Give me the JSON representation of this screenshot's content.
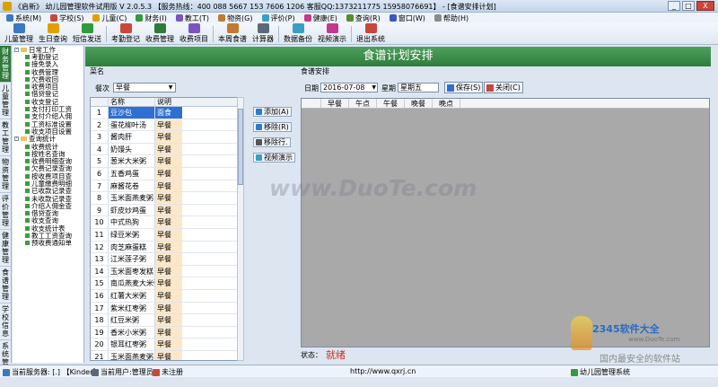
{
  "window": {
    "title": "《启新》 幼儿园管理软件试用版 V 2.0.5.3 【服务热线：400 088 5667  153 7606 1206  客服QQ:1373211775  15958076691】 - [食谱安排计划]",
    "controls": [
      "_",
      "□",
      "X"
    ]
  },
  "menu": [
    {
      "label": "系统(M)",
      "color": "#3a78c2"
    },
    {
      "label": "学校(S)",
      "color": "#c9463d"
    },
    {
      "label": "儿童(C)",
      "color": "#e0a000"
    },
    {
      "label": "财务(I)",
      "color": "#2f9a3f"
    },
    {
      "label": "教工(T)",
      "color": "#7a55c2"
    },
    {
      "label": "物资(G)",
      "color": "#c27a2f"
    },
    {
      "label": "评价(P)",
      "color": "#3a9ec2"
    },
    {
      "label": "健康(E)",
      "color": "#c23a8a"
    },
    {
      "label": "查询(R)",
      "color": "#5a8a2f"
    },
    {
      "label": "窗口(W)",
      "color": "#3a58c2"
    },
    {
      "label": "帮助(H)",
      "color": "#8a8a8a"
    }
  ],
  "toolbar": [
    {
      "label": "儿童管理",
      "color": "#3a78c2"
    },
    {
      "label": "生日查询",
      "color": "#e0a000"
    },
    {
      "label": "短信发送",
      "color": "#2f9a3f"
    },
    {
      "label": "考勤登记",
      "color": "#c9463d"
    },
    {
      "label": "收费管理",
      "color": "#2f7a3a"
    },
    {
      "label": "收费项目",
      "color": "#7a55c2"
    },
    {
      "label": "本周食谱",
      "color": "#c27a2f"
    },
    {
      "label": "计算器",
      "color": "#5a6a7a"
    },
    {
      "label": "数据备份",
      "color": "#3a9ec2"
    },
    {
      "label": "视频演示",
      "color": "#c23a8a"
    },
    {
      "label": "退出系统",
      "color": "#c9463d"
    }
  ],
  "sidetabs": [
    "财务管理",
    "儿童管理",
    "教工管理",
    "物资管理",
    "评价管理",
    "健康管理",
    "食谱管理",
    "学校信息",
    "系统管理"
  ],
  "tree": {
    "groups": [
      {
        "label": "日常工作",
        "items": [
          "考勤登记",
          "接免录入",
          "收费管理",
          "欠费收回",
          "收费项目",
          "借贷登记",
          "收支登记",
          "支付打印工资",
          "支付介绍人佣",
          "工资标准设置",
          "收支项目设置"
        ]
      },
      {
        "label": "查询统计",
        "items": [
          "收费统计",
          "按姓名查询",
          "收费明细查询",
          "欠费记录查询",
          "按收费项目查",
          "儿童缴费明细",
          "已收款记录查",
          "未收款记录查",
          "介绍人佣金查",
          "借贷查询",
          "收支查询",
          "收支统计表",
          "教工工资查询",
          "预收费通知单"
        ]
      }
    ]
  },
  "page": {
    "header": "食谱计划安排"
  },
  "dish": {
    "section_label": "菜名",
    "meal_label": "餐次",
    "meal_value": "早餐",
    "col_name": "名称",
    "col_desc": "说明",
    "rows": [
      [
        "1",
        "豆沙包",
        "面食"
      ],
      [
        "2",
        "蛋花柳叶汤",
        "早餐"
      ],
      [
        "3",
        "酱肉肝",
        "早餐"
      ],
      [
        "4",
        "奶馒头",
        "早餐"
      ],
      [
        "5",
        "葱米大米粥",
        "早餐"
      ],
      [
        "6",
        "五香鸡蛋",
        "早餐"
      ],
      [
        "7",
        "麻酱花卷",
        "早餐"
      ],
      [
        "8",
        "玉米面燕麦粥",
        "早餐"
      ],
      [
        "9",
        "虾皮炒鸡蛋",
        "早餐"
      ],
      [
        "10",
        "中式热狗",
        "早餐"
      ],
      [
        "11",
        "绿豆米粥",
        "早餐"
      ],
      [
        "12",
        "肉芝麻蛋糕",
        "早餐"
      ],
      [
        "13",
        "江米莲子粥",
        "早餐"
      ],
      [
        "14",
        "玉米面枣发糕",
        "早餐"
      ],
      [
        "15",
        "南瓜燕麦大米粥",
        "早餐"
      ],
      [
        "16",
        "红薯大米粥",
        "早餐"
      ],
      [
        "17",
        "紫米红枣粥",
        "早餐"
      ],
      [
        "18",
        "红豆米粥",
        "早餐"
      ],
      [
        "19",
        "香米小米粥",
        "早餐"
      ],
      [
        "20",
        "银耳红枣粥",
        "早餐"
      ],
      [
        "21",
        "玉米面燕麦粥",
        "早餐"
      ]
    ]
  },
  "actions": {
    "add": "添加(A)",
    "remove": "移除(R)",
    "remove_row": "移除行.",
    "video": "视频演示"
  },
  "meal": {
    "section_label": "食谱安排",
    "date_label": "日期",
    "date_value": "2016-07-08",
    "week_label": "星期",
    "week_value": "星期五",
    "save": "保存(S)",
    "close": "关闭(C)",
    "columns": [
      "早餐",
      "午点",
      "午餐",
      "晚餐",
      "晚点"
    ],
    "status_label": "状态：",
    "status_value": "就绪"
  },
  "taskbar": {
    "server": "当前服务器: [.] 【Kinder】",
    "user": "当前用户:管理员",
    "reg": "未注册",
    "url": "http://www.qxrj.cn",
    "app": "幼儿园管理系统"
  },
  "watermarks": {
    "duote": "www.DuoTe.com",
    "logo": "2345软件大全",
    "logo_url": "www.DuoTe.com",
    "secure": "国内最安全的软件站"
  },
  "colors": {
    "header_green": "#2f7d3d",
    "selection_blue": "#2f6fd1",
    "status_red": "#d12c1c"
  }
}
